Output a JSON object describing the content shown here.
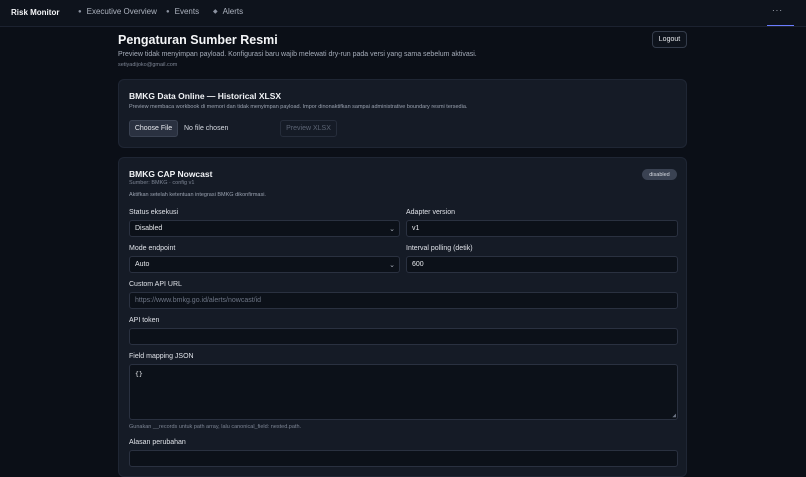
{
  "topbar": {
    "brand": "Risk Monitor",
    "nav": [
      {
        "label": "Executive Overview",
        "icon": "dashboard-icon"
      },
      {
        "label": "Events",
        "icon": "events-icon"
      },
      {
        "label": "Alerts",
        "icon": "alert-icon"
      }
    ],
    "more": "···"
  },
  "page": {
    "title": "Pengaturan Sumber Resmi",
    "subtitle": "Preview tidak menyimpan payload. Konfigurasi baru wajib melewati dry-run pada versi yang sama sebelum aktivasi.",
    "email": "setiyadijoko@gmail.com",
    "logout": "Logout"
  },
  "import_card": {
    "title": "BMKG Data Online — Historical XLSX",
    "desc": "Preview membaca workbook di memori dan tidak menyimpan payload. Impor dinonaktifkan sampai administrative boundary resmi tersedia.",
    "choose_file": "Choose File",
    "no_file": "No file chosen",
    "preview": "Preview XLSX"
  },
  "source_card": {
    "title": "BMKG CAP Nowcast",
    "badge": "disabled",
    "meta": "Sumber: BMKG · config v1",
    "note": "Aktifkan setelah ketentuan integrasi BMKG dikonfirmasi.",
    "status_label": "Status eksekusi",
    "status_value": "Disabled",
    "adapter_label": "Adapter version",
    "adapter_value": "v1",
    "mode_label": "Mode endpoint",
    "mode_value": "Auto",
    "interval_label": "Interval polling (detik)",
    "interval_value": "600",
    "url_label": "Custom API URL",
    "url_placeholder": "https://www.bmkg.go.id/alerts/nowcast/id",
    "token_label": "API token",
    "token_value": "",
    "mapping_label": "Field mapping JSON",
    "mapping_value": "{}",
    "mapping_hint": "Gunakan __records untuk path array, lalu canonical_field: nested.path.",
    "reason_label": "Alasan perubahan"
  }
}
